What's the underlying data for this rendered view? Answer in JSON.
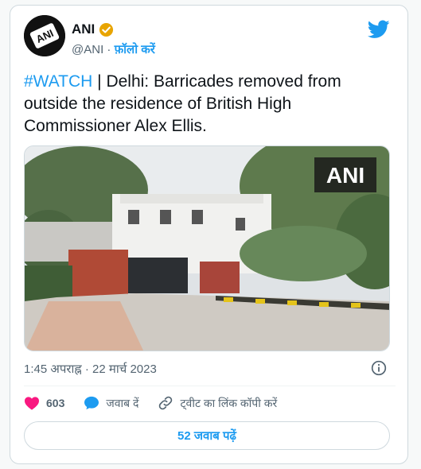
{
  "colors": {
    "accent": "#1d9bf0",
    "like": "#f91880",
    "verified": "#e8a400",
    "text": "#0f1419",
    "muted": "#536471"
  },
  "author": {
    "name": "ANI",
    "handle": "@ANI",
    "separator": " · ",
    "follow_label": "फ़ॉलो करें",
    "avatar_text": "ANI"
  },
  "tweet": {
    "hashtag": "#WATCH",
    "text": " | Delhi: Barricades removed from outside the residence of British High Commissioner Alex Ellis."
  },
  "media": {
    "watermark": "ANI"
  },
  "meta": {
    "time": "1:45 अपराह्न",
    "separator": " · ",
    "date": "22 मार्च 2023"
  },
  "actions": {
    "like_count": "603",
    "reply_label": "जवाब दें",
    "copy_link_label": "ट्वीट का लिंक कॉपी करें"
  },
  "replies_button": "52 जवाब पढ़ें",
  "icons": [
    "twitter-logo-icon",
    "verified-badge-icon",
    "info-icon",
    "heart-icon",
    "reply-bubble-icon",
    "link-icon"
  ]
}
